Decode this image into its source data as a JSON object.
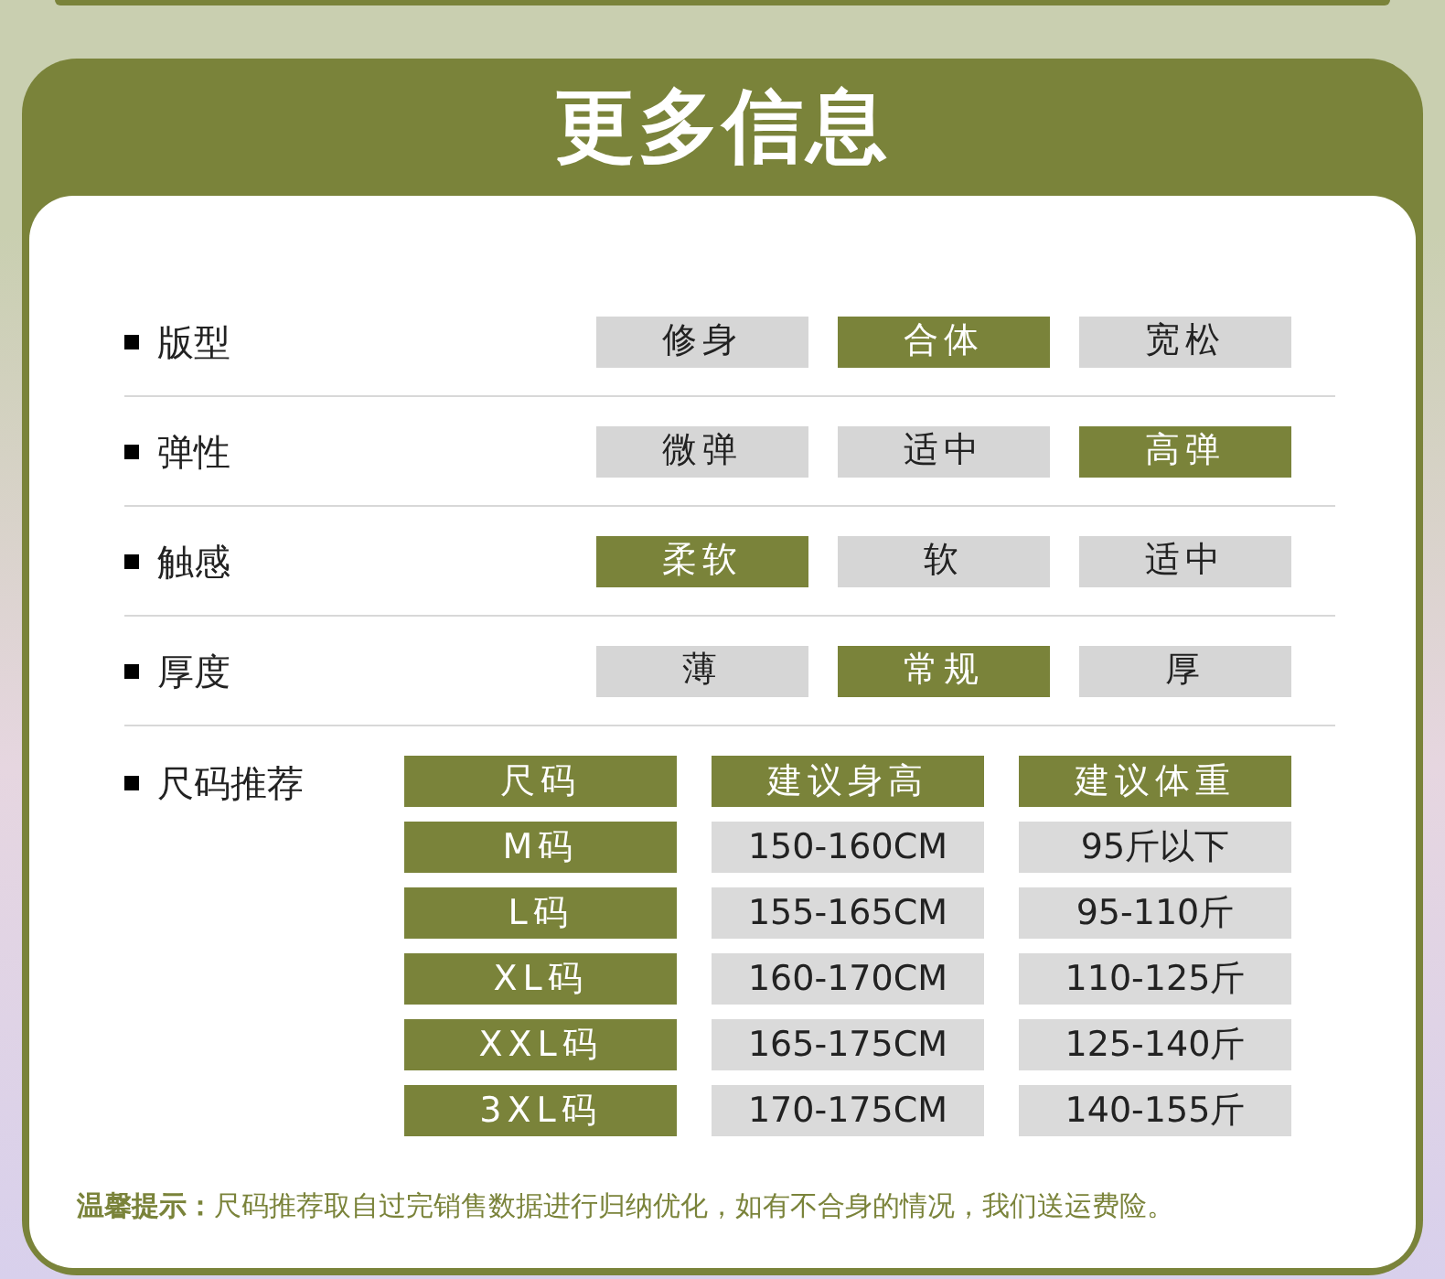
{
  "title": "更多信息",
  "attributes": [
    {
      "label": "版型",
      "options": [
        {
          "text": "修身",
          "selected": false
        },
        {
          "text": "合体",
          "selected": true
        },
        {
          "text": "宽松",
          "selected": false
        }
      ]
    },
    {
      "label": "弹性",
      "options": [
        {
          "text": "微弹",
          "selected": false
        },
        {
          "text": "适中",
          "selected": false
        },
        {
          "text": "高弹",
          "selected": true
        }
      ]
    },
    {
      "label": "触感",
      "options": [
        {
          "text": "柔软",
          "selected": true
        },
        {
          "text": "软",
          "selected": false
        },
        {
          "text": "适中",
          "selected": false
        }
      ]
    },
    {
      "label": "厚度",
      "options": [
        {
          "text": "薄",
          "selected": false
        },
        {
          "text": "常规",
          "selected": true
        },
        {
          "text": "厚",
          "selected": false
        }
      ]
    }
  ],
  "size_table": {
    "label": "尺码推荐",
    "columns": [
      "尺码",
      "建议身高",
      "建议体重"
    ],
    "rows": [
      [
        "M码",
        "150-160CM",
        "95斤以下"
      ],
      [
        "L码",
        "155-165CM",
        "95-110斤"
      ],
      [
        "XL码",
        "160-170CM",
        "110-125斤"
      ],
      [
        "XXL码",
        "165-175CM",
        "125-140斤"
      ],
      [
        "3XL码",
        "170-175CM",
        "140-155斤"
      ]
    ]
  },
  "note": "**温馨提示：**尺码推荐取自过完销售数据进行归纳优化，如有不合身的情况，我们送运费险。"
}
